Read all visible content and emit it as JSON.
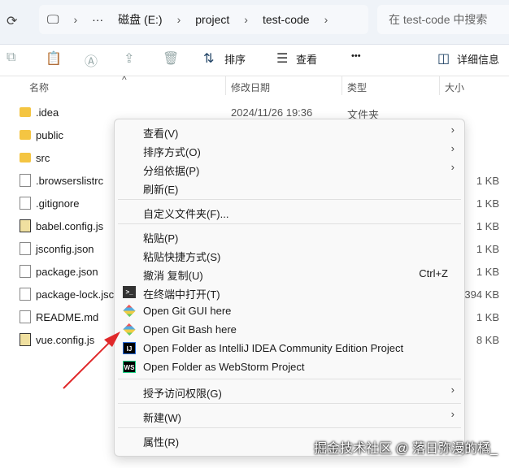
{
  "address": {
    "crumbs": [
      "磁盘 (E:)",
      "project",
      "test-code"
    ],
    "search_placeholder": "在 test-code 中搜索"
  },
  "toolbar": {
    "sort": "排序",
    "view": "查看",
    "more": "•••",
    "details": "详细信息"
  },
  "columns": {
    "name": "名称",
    "date": "修改日期",
    "type": "类型",
    "size": "大小"
  },
  "files": [
    {
      "name": ".idea",
      "kind": "folder",
      "date": "2024/11/26 19:36",
      "type": "文件夹",
      "size": ""
    },
    {
      "name": "public",
      "kind": "folder",
      "date": "",
      "type": "",
      "size": ""
    },
    {
      "name": "src",
      "kind": "folder",
      "date": "",
      "type": "",
      "size": ""
    },
    {
      "name": ".browserslistrc",
      "kind": "file",
      "date": "",
      "type": "",
      "size": "1 KB"
    },
    {
      "name": ".gitignore",
      "kind": "file",
      "date": "",
      "type": "",
      "size": "1 KB"
    },
    {
      "name": "babel.config.js",
      "kind": "js",
      "date": "",
      "type": "",
      "size": "1 KB"
    },
    {
      "name": "jsconfig.json",
      "kind": "file",
      "date": "",
      "type": "",
      "size": "1 KB"
    },
    {
      "name": "package.json",
      "kind": "file",
      "date": "",
      "type": "",
      "size": "1 KB"
    },
    {
      "name": "package-lock.jsc",
      "kind": "file",
      "date": "",
      "type": "",
      "size": "394 KB"
    },
    {
      "name": "README.md",
      "kind": "file",
      "date": "",
      "type": "",
      "size": "1 KB"
    },
    {
      "name": "vue.config.js",
      "kind": "js",
      "date": "",
      "type": "",
      "size": "8 KB"
    }
  ],
  "menu": [
    {
      "label": "查看(V)",
      "arrow": true
    },
    {
      "label": "排序方式(O)",
      "arrow": true
    },
    {
      "label": "分组依据(P)",
      "arrow": true
    },
    {
      "label": "刷新(E)"
    },
    {
      "sep": true
    },
    {
      "label": "自定义文件夹(F)..."
    },
    {
      "sep": true
    },
    {
      "label": "粘贴(P)"
    },
    {
      "label": "粘贴快捷方式(S)"
    },
    {
      "label": "撤消 复制(U)",
      "shortcut": "Ctrl+Z"
    },
    {
      "label": "在终端中打开(T)",
      "icon": "terminal"
    },
    {
      "label": "Open Git GUI here",
      "icon": "git"
    },
    {
      "label": "Open Git Bash here",
      "icon": "git"
    },
    {
      "label": "Open Folder as IntelliJ IDEA Community Edition Project",
      "icon": "ij",
      "icon_text": "IJ"
    },
    {
      "label": "Open Folder as WebStorm Project",
      "icon": "ws",
      "icon_text": "WS"
    },
    {
      "sep": true
    },
    {
      "label": "授予访问权限(G)",
      "arrow": true
    },
    {
      "sep": true
    },
    {
      "label": "新建(W)",
      "arrow": true
    },
    {
      "sep": true
    },
    {
      "label": "属性(R)"
    }
  ],
  "watermark": "掘金技术社区 @ 落日弥漫的橘_",
  "colors": {
    "arrow": "#e0282a",
    "folder": "#f4c542"
  }
}
